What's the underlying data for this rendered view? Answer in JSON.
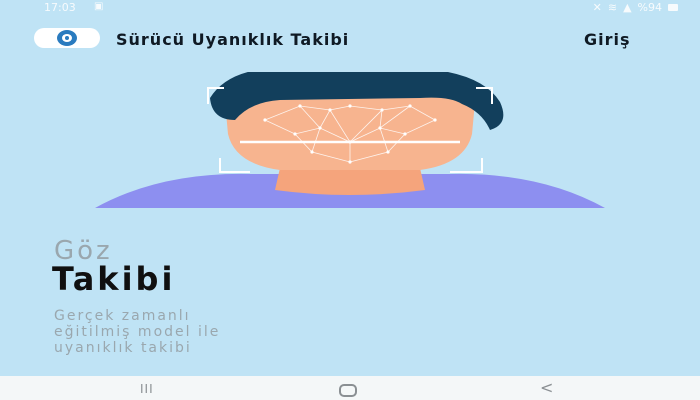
{
  "status_bar": {
    "time": "17:03",
    "battery": "%94",
    "icons": [
      "gallery-icon",
      "mute-icon",
      "wifi-icon",
      "signal-icon",
      "battery-icon"
    ]
  },
  "header": {
    "title": "Sürücü Uyanıklık Takibi",
    "login_label": "Giriş"
  },
  "hero": {
    "headline_light": "Göz",
    "headline_bold": "Takibi",
    "description_lines": [
      "Gerçek zamanlı",
      "eğitilmiş model ile",
      "uyanıklık takibi"
    ]
  },
  "nav_bar": {
    "recent_glyph": "III",
    "back_glyph": "<"
  },
  "colors": {
    "background": "#bfe3f5",
    "hair": "#123f5c",
    "skin": "#f7b48f",
    "shirt": "#8d8ff0",
    "title_text": "#0f1a24",
    "muted_text": "#9aa7ae"
  }
}
